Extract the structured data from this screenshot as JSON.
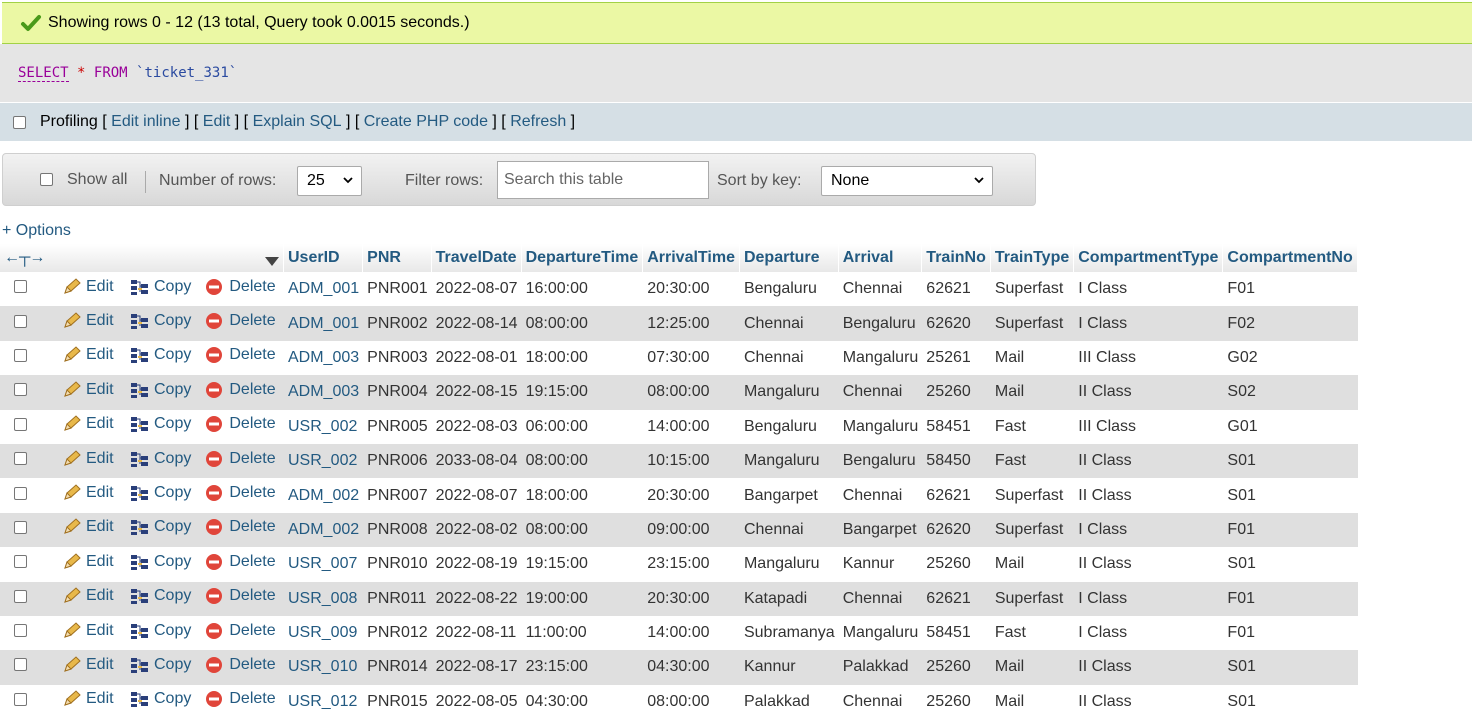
{
  "status": {
    "message": "Showing rows 0 - 12 (13 total, Query took 0.0015 seconds.)"
  },
  "sql": {
    "select": "SELECT",
    "star": "*",
    "from": "FROM",
    "table": "`ticket_331`"
  },
  "profiling": {
    "label": "Profiling",
    "links": [
      "Edit inline",
      "Edit",
      "Explain SQL",
      "Create PHP code",
      "Refresh"
    ]
  },
  "nav": {
    "show_all": "Show all",
    "rows_label": "Number of rows:",
    "rows_value": "25",
    "filter_label": "Filter rows:",
    "search_placeholder": "Search this table",
    "sort_label": "Sort by key:",
    "sort_value": "None"
  },
  "options_link": "+ Options",
  "row_actions": {
    "edit": "Edit",
    "copy": "Copy",
    "delete": "Delete"
  },
  "columns": [
    "UserID",
    "PNR",
    "TravelDate",
    "DepartureTime",
    "ArrivalTime",
    "Departure",
    "Arrival",
    "TrainNo",
    "TrainType",
    "CompartmentType",
    "CompartmentNo"
  ],
  "rows": [
    [
      "ADM_001",
      "PNR001",
      "2022-08-07",
      "16:00:00",
      "20:30:00",
      "Bengaluru",
      "Chennai",
      "62621",
      "Superfast",
      "I Class",
      "F01"
    ],
    [
      "ADM_001",
      "PNR002",
      "2022-08-14",
      "08:00:00",
      "12:25:00",
      "Chennai",
      "Bengaluru",
      "62620",
      "Superfast",
      "I Class",
      "F02"
    ],
    [
      "ADM_003",
      "PNR003",
      "2022-08-01",
      "18:00:00",
      "07:30:00",
      "Chennai",
      "Mangaluru",
      "25261",
      "Mail",
      "III Class",
      "G02"
    ],
    [
      "ADM_003",
      "PNR004",
      "2022-08-15",
      "19:15:00",
      "08:00:00",
      "Mangaluru",
      "Chennai",
      "25260",
      "Mail",
      "II Class",
      "S02"
    ],
    [
      "USR_002",
      "PNR005",
      "2022-08-03",
      "06:00:00",
      "14:00:00",
      "Bengaluru",
      "Mangaluru",
      "58451",
      "Fast",
      "III Class",
      "G01"
    ],
    [
      "USR_002",
      "PNR006",
      "2033-08-04",
      "08:00:00",
      "10:15:00",
      "Mangaluru",
      "Bengaluru",
      "58450",
      "Fast",
      "II Class",
      "S01"
    ],
    [
      "ADM_002",
      "PNR007",
      "2022-08-07",
      "18:00:00",
      "20:30:00",
      "Bangarpet",
      "Chennai",
      "62621",
      "Superfast",
      "II Class",
      "S01"
    ],
    [
      "ADM_002",
      "PNR008",
      "2022-08-02",
      "08:00:00",
      "09:00:00",
      "Chennai",
      "Bangarpet",
      "62620",
      "Superfast",
      "I Class",
      "F01"
    ],
    [
      "USR_007",
      "PNR010",
      "2022-08-19",
      "19:15:00",
      "23:15:00",
      "Mangaluru",
      "Kannur",
      "25260",
      "Mail",
      "II Class",
      "S01"
    ],
    [
      "USR_008",
      "PNR011",
      "2022-08-22",
      "19:00:00",
      "20:30:00",
      "Katapadi",
      "Chennai",
      "62621",
      "Superfast",
      "I Class",
      "F01"
    ],
    [
      "USR_009",
      "PNR012",
      "2022-08-11",
      "11:00:00",
      "14:00:00",
      "Subramanya",
      "Mangaluru",
      "58451",
      "Fast",
      "I Class",
      "F01"
    ],
    [
      "USR_010",
      "PNR014",
      "2022-08-17",
      "23:15:00",
      "04:30:00",
      "Kannur",
      "Palakkad",
      "25260",
      "Mail",
      "II Class",
      "S01"
    ],
    [
      "USR_012",
      "PNR015",
      "2022-08-05",
      "04:30:00",
      "08:00:00",
      "Palakkad",
      "Chennai",
      "25260",
      "Mail",
      "II Class",
      "S01"
    ]
  ]
}
